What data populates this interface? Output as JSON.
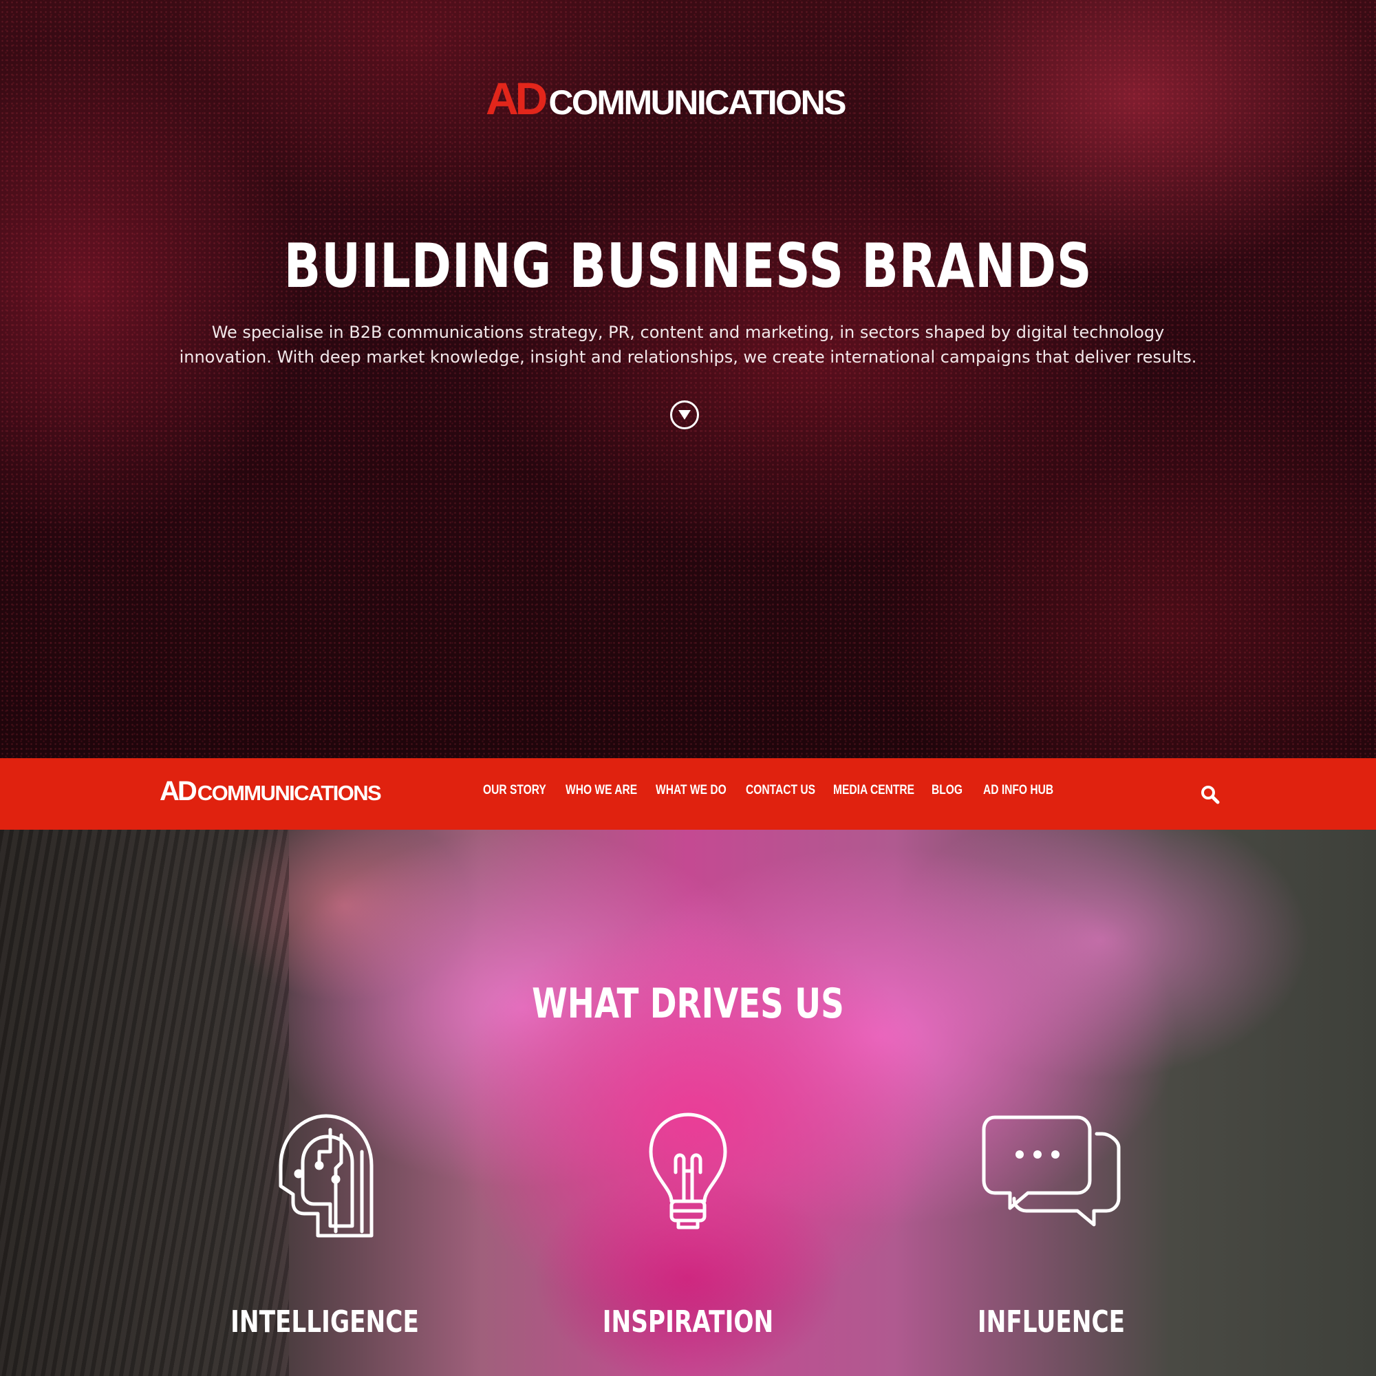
{
  "hero": {
    "logo": {
      "ad": "AD",
      "communications": "COMMUNICATIONS"
    },
    "title": "BUILDING BUSINESS BRANDS",
    "description_line1": "We specialise in B2B communications strategy, PR, content and marketing, in sectors shaped by digital technology",
    "description_line2": "innovation. With deep market knowledge, insight and relationships, we create international campaigns that deliver results.",
    "scroll_icon": "chevron-down-circle-icon"
  },
  "nav": {
    "logo": {
      "ad": "AD",
      "communications": "COMMUNICATIONS"
    },
    "items": [
      {
        "label": "OUR STORY"
      },
      {
        "label": "WHO WE ARE"
      },
      {
        "label": "WHAT WE DO"
      },
      {
        "label": "CONTACT US"
      },
      {
        "label": "MEDIA CENTRE"
      },
      {
        "label": "BLOG"
      },
      {
        "label": "AD INFO HUB"
      }
    ],
    "search_icon": "search-icon"
  },
  "drives": {
    "title": "WHAT DRIVES US",
    "pillars": [
      {
        "label": "INTELLIGENCE",
        "icon": "head-circuit-icon"
      },
      {
        "label": "INSPIRATION",
        "icon": "lightbulb-icon"
      },
      {
        "label": "INFLUENCE",
        "icon": "chat-bubbles-icon"
      }
    ]
  },
  "colors": {
    "brand_red": "#e0220f",
    "hero_dark_red": "#2a0710",
    "white": "#ffffff"
  }
}
